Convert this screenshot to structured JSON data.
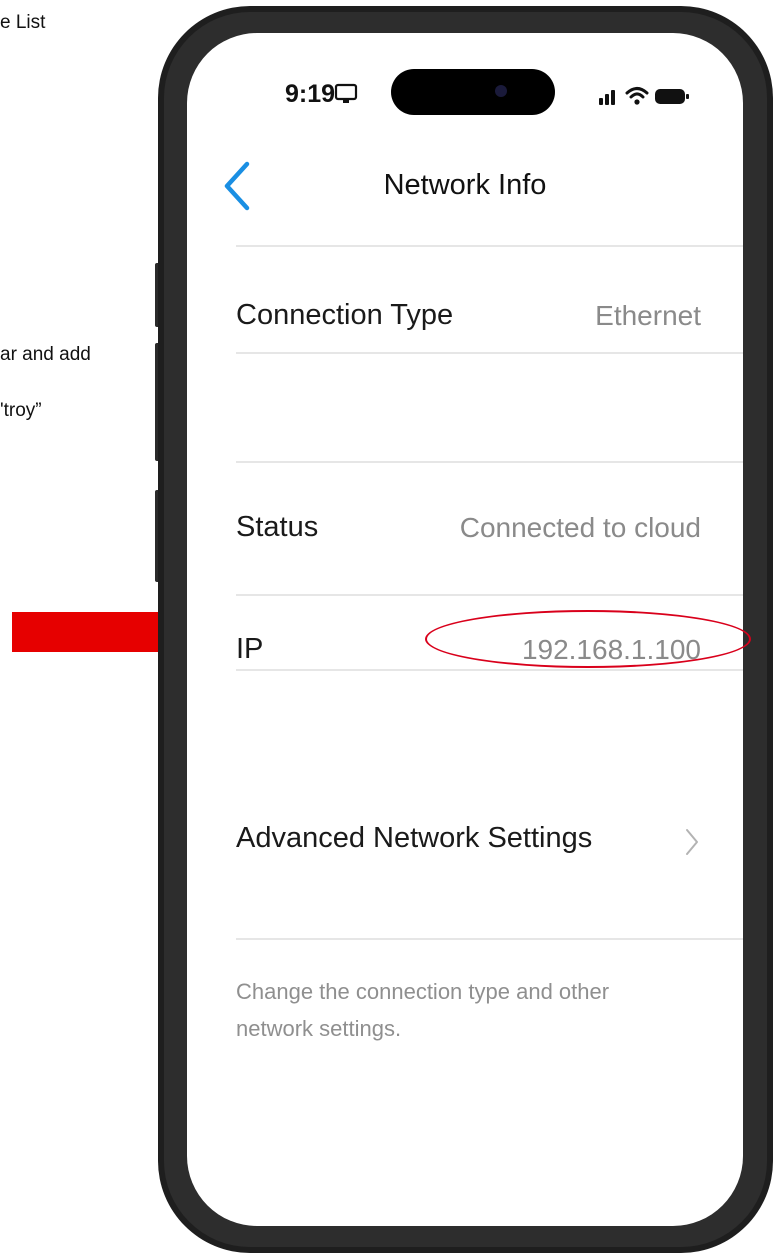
{
  "background_doc": {
    "line1": "e List",
    "line2": "ar and add",
    "line3": "'troy”"
  },
  "status_bar": {
    "time": "9:19"
  },
  "nav": {
    "title": "Network Info",
    "back_icon": "chevron-left-icon"
  },
  "rows": {
    "connection_type": {
      "label": "Connection Type",
      "value": "Ethernet"
    },
    "status": {
      "label": "Status",
      "value": "Connected to cloud"
    },
    "ip": {
      "label": "IP",
      "value": "192.168.1.100"
    },
    "advanced": {
      "label": "Advanced Network Settings",
      "icon": "chevron-right-icon"
    }
  },
  "footnote": "Change the connection type and other network settings.",
  "colors": {
    "accent": "#1a8fe3",
    "annotation": "#e60000",
    "value_text": "#8a8a8a"
  }
}
